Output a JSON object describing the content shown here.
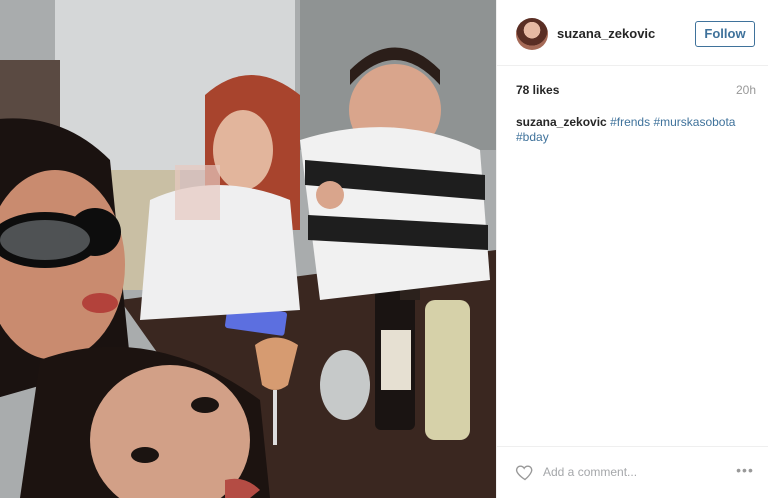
{
  "post": {
    "photo_icon": "photo",
    "username": "suzana_zekovic",
    "follow_label": "Follow",
    "likes": "78 likes",
    "time": "20h",
    "caption": {
      "user": "suzana_zekovic",
      "tags": [
        "#frends",
        "#murskasobota",
        "#bday"
      ]
    },
    "comment_placeholder": "Add a comment...",
    "more_label": "•••",
    "icons": {
      "like": "heart-icon",
      "more": "more-options-icon",
      "avatar": "avatar"
    },
    "colors": {
      "link": "#3f729b",
      "text": "#262626",
      "muted": "#999999",
      "border": "#efefef"
    }
  }
}
